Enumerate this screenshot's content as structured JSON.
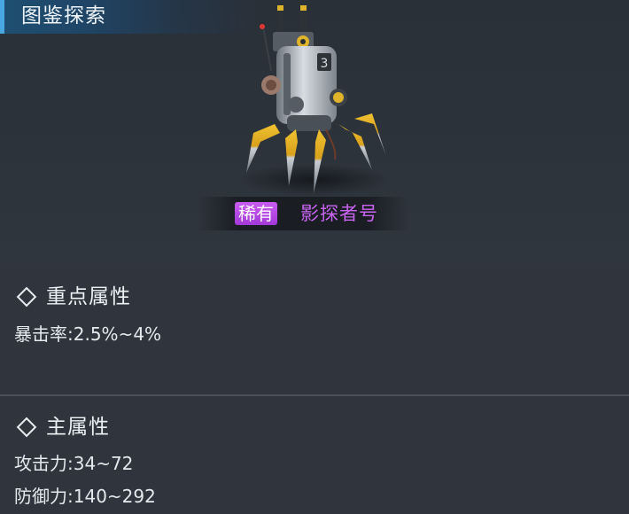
{
  "header": {
    "title": "图鉴探索"
  },
  "unit": {
    "rarity": "稀有",
    "name": "影探者号",
    "rarity_color": "#b44ae4",
    "name_color": "#c864f2",
    "icon": "robot-spider-drone"
  },
  "key_attributes": {
    "title": "重点属性",
    "stats": [
      {
        "label": "暴击率:",
        "value": "2.5%~4%"
      }
    ]
  },
  "main_attributes": {
    "title": "主属性",
    "stats": [
      {
        "label": "攻击力:",
        "value": "34~72"
      },
      {
        "label": "防御力:",
        "value": "140~292"
      }
    ]
  }
}
